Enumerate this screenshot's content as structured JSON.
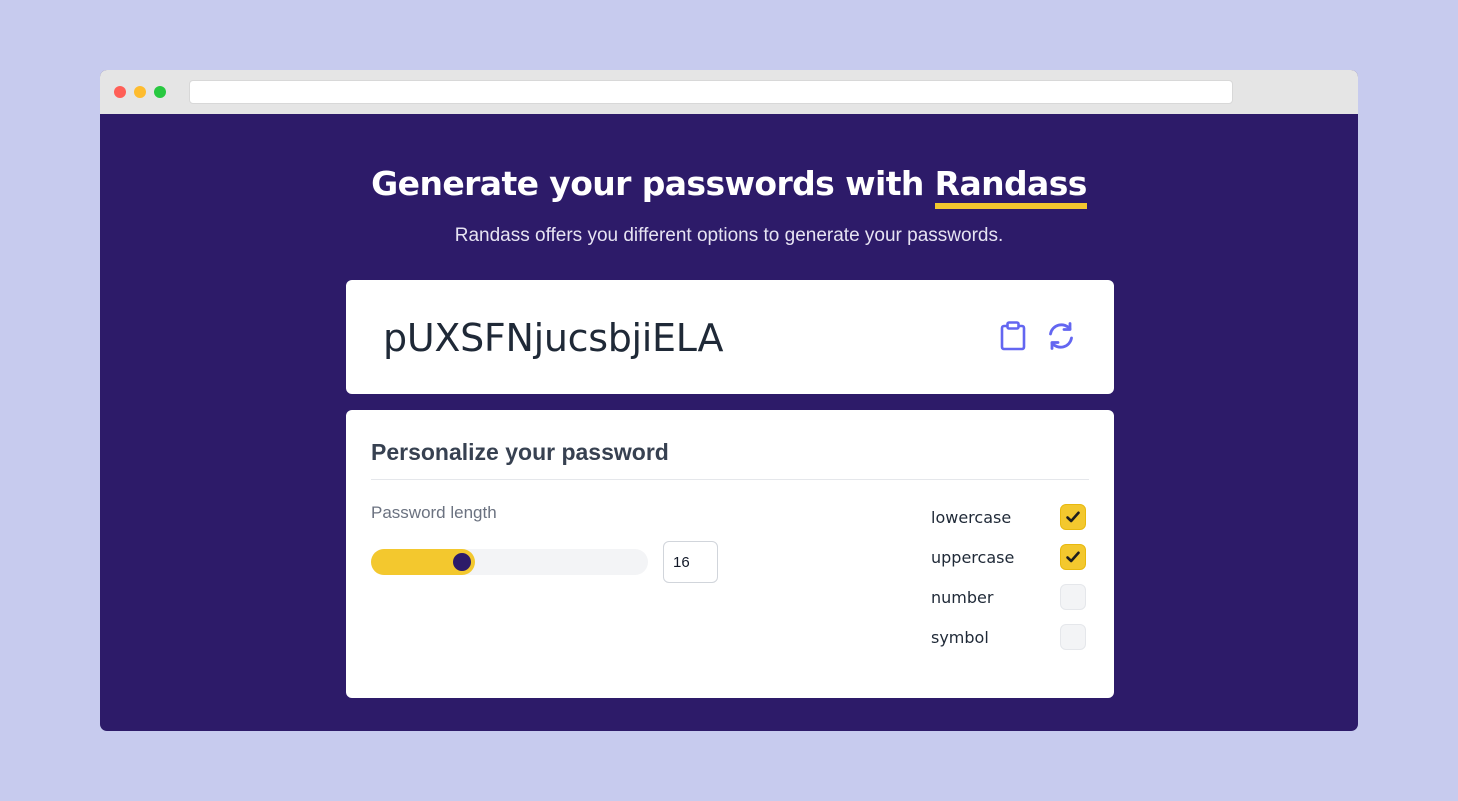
{
  "browser": {
    "url": ""
  },
  "hero": {
    "title_prefix": "Generate your passwords with ",
    "title_brand": "Randass",
    "subtitle": "Randass offers you different options to generate your passwords."
  },
  "password": {
    "value": "pUXSFNjucsbjiELA",
    "copy_icon": "clipboard-icon",
    "refresh_icon": "refresh-icon"
  },
  "options": {
    "title": "Personalize your password",
    "length_label": "Password length",
    "length_value": "16",
    "length_fraction": 0.32,
    "checkboxes": [
      {
        "label": "lowercase",
        "checked": true
      },
      {
        "label": "uppercase",
        "checked": true
      },
      {
        "label": "number",
        "checked": false
      },
      {
        "label": "symbol",
        "checked": false
      }
    ]
  },
  "colors": {
    "background": "#c7cbee",
    "page": "#2d1b69",
    "accent": "#f3c82e",
    "icon": "#6366f1"
  }
}
